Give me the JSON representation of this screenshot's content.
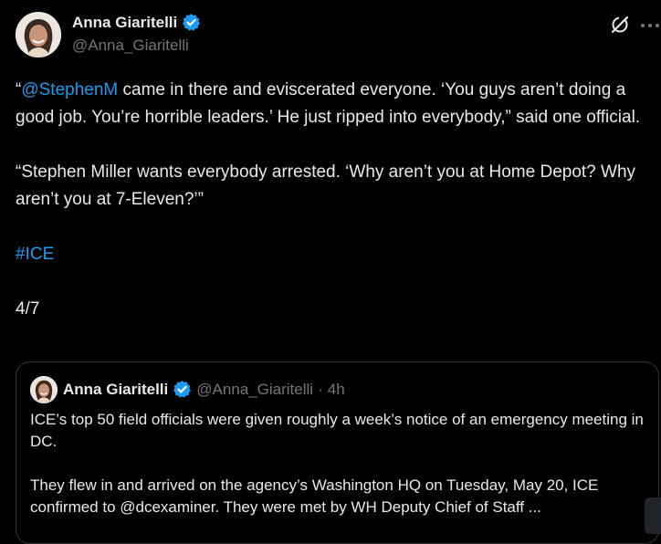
{
  "tweet": {
    "author": {
      "name": "Anna Giaritelli",
      "handle": "@Anna_Giaritelli",
      "verified": true
    },
    "body": {
      "p1_open": "“",
      "p1_mention": "@StephenM",
      "p1_rest": " came in there and eviscerated everyone. ‘You guys aren’t doing a good job. You’re horrible leaders.’ He just ripped into everybody,” said one official.",
      "p2": "“Stephen Miller wants everybody arrested. ‘Why aren’t you at Home Depot? Why aren’t you at 7-Eleven?’”",
      "hashtag": "#ICE",
      "thread_counter": "4/7"
    },
    "icons": {
      "grok": "grok-icon",
      "more": "more-icon",
      "verified": "verified-badge-icon"
    }
  },
  "quote": {
    "name": "Anna Giaritelli",
    "handle": "@Anna_Giaritelli",
    "dot": "·",
    "time": "4h",
    "p1": "ICE’s top 50 field officials were given roughly a week’s notice of an emergency meeting in DC.",
    "p2": "They flew in and arrived on the agency’s Washington HQ on Tuesday, May 20, ICE confirmed to @dcexaminer. They were met by WH Deputy Chief of Staff ..."
  },
  "colors": {
    "background": "#000000",
    "text": "#e7e9ea",
    "secondary": "#71767b",
    "link": "#1d9bf0",
    "border": "#2f3336"
  }
}
